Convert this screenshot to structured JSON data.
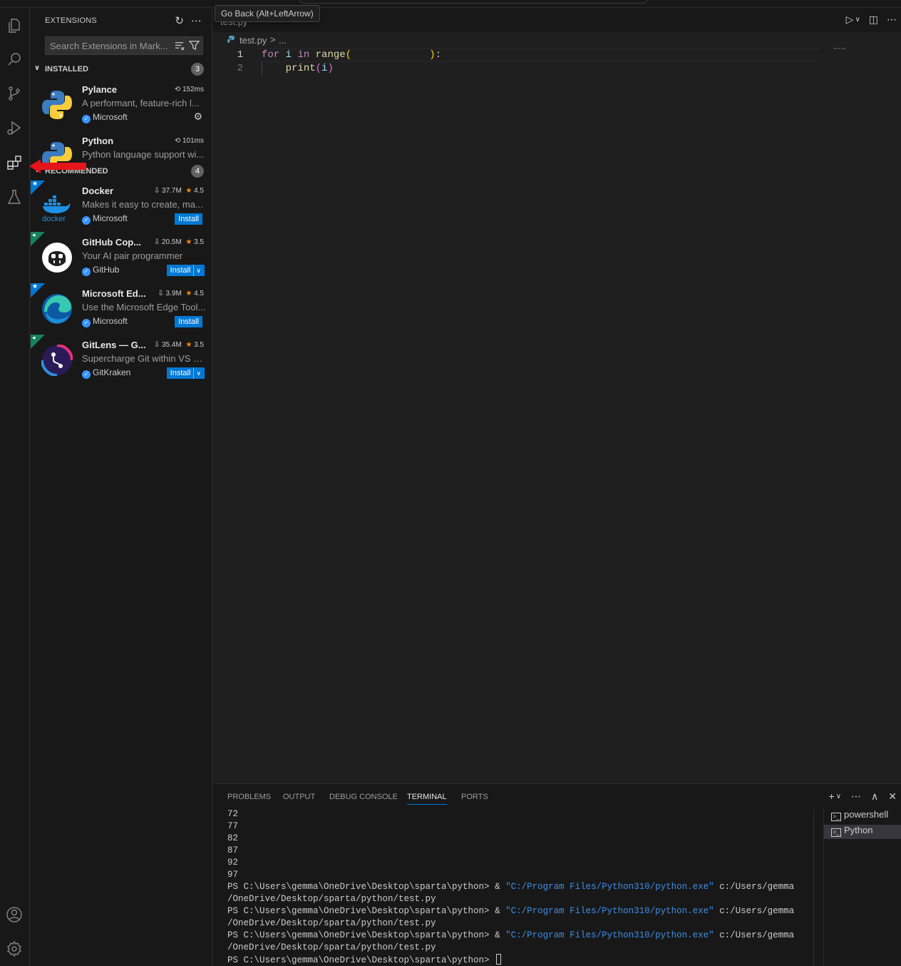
{
  "tooltip": "Go Back (Alt+LeftArrow)",
  "activity_bar": {
    "icons": [
      "explorer-icon",
      "search-icon",
      "source-control-icon",
      "run-debug-icon",
      "extensions-icon",
      "testing-icon",
      "account-icon",
      "settings-gear-icon"
    ]
  },
  "sidebar": {
    "title": "EXTENSIONS",
    "search_placeholder": "Search Extensions in Mark...",
    "installed": {
      "label": "INSTALLED",
      "count": "3",
      "items": [
        {
          "name": "Pylance",
          "meta": "152ms",
          "desc": "A performant, feature-rich l...",
          "publisher": "Microsoft"
        },
        {
          "name": "Python",
          "meta": "101ms",
          "desc": "Python language support wi..."
        }
      ]
    },
    "recommended": {
      "label": "RECOMMENDED",
      "count": "4",
      "items": [
        {
          "name": "Docker",
          "downloads": "37.7M",
          "rating": "4.5",
          "desc": "Makes it easy to create, ma...",
          "publisher": "Microsoft",
          "install": "Install"
        },
        {
          "name": "GitHub Cop...",
          "downloads": "20.5M",
          "rating": "3.5",
          "desc": "Your AI pair programmer",
          "publisher": "GitHub",
          "install": "Install"
        },
        {
          "name": "Microsoft Ed...",
          "downloads": "3.9M",
          "rating": "4.5",
          "desc": "Use the Microsoft Edge Tool...",
          "publisher": "Microsoft",
          "install": "Install"
        },
        {
          "name": "GitLens — G...",
          "downloads": "35.4M",
          "rating": "3.5",
          "desc": "Supercharge Git within VS C...",
          "publisher": "GitKraken",
          "install": "Install"
        }
      ]
    }
  },
  "editor": {
    "tab_ghost": "test.py",
    "breadcrumb_file": "test.py",
    "breadcrumb_sep": ">",
    "breadcrumb_more": "...",
    "lines": [
      {
        "num": "1",
        "kw1": "for",
        "var": " i ",
        "kw2": "in",
        "fn": " range",
        "open": "(",
        "space": "             ",
        "close": ")",
        "colon": ":"
      },
      {
        "num": "2",
        "indent": "    ",
        "fn": "print",
        "open": "(",
        "var": "i",
        "close": ")"
      }
    ]
  },
  "panel": {
    "tabs": [
      "PROBLEMS",
      "OUTPUT",
      "DEBUG CONSOLE",
      "TERMINAL",
      "PORTS"
    ],
    "active_tab": "TERMINAL",
    "terminal_numbers": [
      "72",
      "77",
      "82",
      "87",
      "92",
      "97"
    ],
    "prompt": "PS C:\\Users\\gemma\\OneDrive\\Desktop\\sparta\\python> ",
    "cmd_amp": "& ",
    "cmd_exe": "\"C:/Program Files/Python310/python.exe\"",
    "cmd_arg1": " c:/Users/gemma",
    "cmd_arg2": "/OneDrive/Desktop/sparta/python/test.py",
    "terminals": [
      "powershell",
      "Python"
    ]
  },
  "colors": {
    "accent": "#0078d4",
    "annotation_arrow": "#e5151b"
  }
}
